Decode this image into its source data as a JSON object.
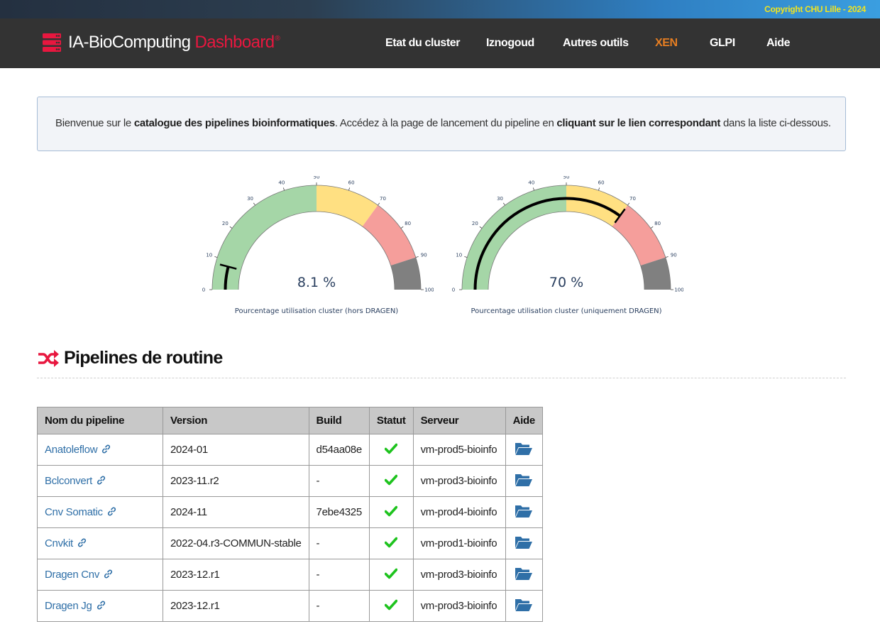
{
  "copyright": "Copyright CHU Lille - 2024",
  "brand": {
    "name": "IA-BioComputing",
    "accent": "Dashboard",
    "mark": "®"
  },
  "nav": [
    {
      "label": "Etat du cluster",
      "active": false
    },
    {
      "label": "Iznogoud",
      "active": false
    },
    {
      "label": "Autres outils",
      "active": false
    },
    {
      "label": "XEN",
      "active": true
    },
    {
      "label": "GLPI",
      "active": false
    },
    {
      "label": "Aide",
      "active": false
    }
  ],
  "welcome": {
    "p1": "Bienvenue sur le ",
    "b1": "catalogue des pipelines bioinformatiques",
    "p2": ". Accédez à la page de lancement du pipeline en ",
    "b2": "cliquant sur le lien correspondant",
    "p3": " dans la liste ci-dessous."
  },
  "gauges": [
    {
      "value": 8.1,
      "display": "8.1 %",
      "label": "Pourcentage utilisation cluster (hors DRAGEN)"
    },
    {
      "value": 70,
      "display": "70 %",
      "label": "Pourcentage utilisation cluster (uniquement DRAGEN)"
    }
  ],
  "gauge_scale": {
    "min": 0,
    "max": 100,
    "ticks": [
      "0",
      "10",
      "20",
      "30",
      "40",
      "50",
      "60",
      "70",
      "80",
      "90",
      "100"
    ],
    "bands": [
      {
        "from": 0,
        "to": 50,
        "color": "#a5d6a7"
      },
      {
        "from": 50,
        "to": 70,
        "color": "#ffe082"
      },
      {
        "from": 70,
        "to": 90,
        "color": "#f59e9b"
      },
      {
        "from": 90,
        "to": 100,
        "color": "#808080"
      }
    ]
  },
  "section": {
    "title": "Pipelines de routine"
  },
  "table": {
    "headers": [
      "Nom du pipeline",
      "Version",
      "Build",
      "Statut",
      "Serveur",
      "Aide"
    ],
    "rows": [
      {
        "name": "Anatoleflow",
        "version": "2024-01",
        "build": "d54aa08e",
        "server": "vm-prod5-bioinfo"
      },
      {
        "name": "Bclconvert",
        "version": "2023-11.r2",
        "build": "-",
        "server": "vm-prod3-bioinfo"
      },
      {
        "name": "Cnv Somatic",
        "version": "2024-11",
        "build": "7ebe4325",
        "server": "vm-prod4-bioinfo"
      },
      {
        "name": "Cnvkit",
        "version": "2022-04.r3-COMMUN-stable",
        "build": "-",
        "server": "vm-prod1-bioinfo"
      },
      {
        "name": "Dragen Cnv",
        "version": "2023-12.r1",
        "build": "-",
        "server": "vm-prod3-bioinfo"
      },
      {
        "name": "Dragen Jg",
        "version": "2023-12.r1",
        "build": "-",
        "server": "vm-prod3-bioinfo"
      }
    ]
  },
  "colors": {
    "accent_red": "#e8173f",
    "nav_active": "#e67e22",
    "check_green": "#1ec31e",
    "folder_blue": "#2f6fa7"
  }
}
